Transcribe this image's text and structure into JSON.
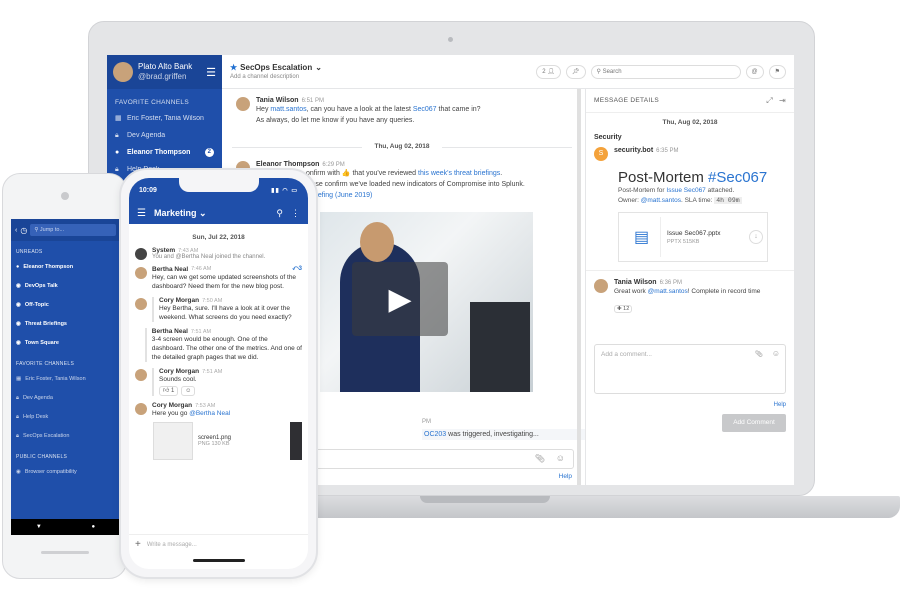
{
  "desktop": {
    "team": {
      "name": "Plato Alto Bank",
      "user": "@brad.griffen"
    },
    "sidebar": {
      "favorites_label": "FAVORITE CHANNELS",
      "channels": [
        {
          "label": "Eric Foster, Tania Wilson",
          "icon": "group-icon"
        },
        {
          "label": "Dev Agenda",
          "icon": "lock-icon"
        },
        {
          "label": "Eleanor Thompson",
          "icon": "user-icon",
          "badge": "2"
        },
        {
          "label": "Help Desk",
          "icon": "lock-icon"
        }
      ]
    },
    "header": {
      "channel": "SecOps Escalation",
      "description": "Add a channel description",
      "member_count": "2",
      "search_placeholder": "Search"
    },
    "messages": {
      "m1": {
        "name": "Tania Wilson",
        "time": "6:51 PM",
        "line1_pre": "Hey ",
        "line1_link": "matt.santos",
        "line1_mid": ", can you have a look at the latest ",
        "line1_link2": "Sec067",
        "line1_post": " that came in?",
        "line2": "As always, do let me know if you have any queries."
      },
      "date_sep": "Thu, Aug 02, 2018",
      "m2": {
        "name": "Eleanor Thompson",
        "time": "6:29 PM",
        "line1_pre": "onfirm with ",
        "line1_emoji": "👍",
        "line1_mid": " that you've reviewed ",
        "line1_link": "this week's threat briefings",
        "line1_post": ".",
        "line2": "lease confirm we've loaded new indicators of Compromise into Splunk.",
        "line3": "riefing (June 2019)"
      },
      "line_pm": "PM",
      "line_last_link": "OC203",
      "line_last": " was triggered, investigating...",
      "help": "Help"
    },
    "details": {
      "title": "MESSAGE DETAILS",
      "date": "Thu, Aug 02, 2018",
      "category": "Security",
      "bot": {
        "name": "security.bot",
        "time": "6:35 PM"
      },
      "post_mortem": "Post-Mortem ",
      "post_tag": "#Sec067",
      "line1_pre": "Post-Mortem for ",
      "line1_link": "Issue Sec067",
      "line1_post": " attached.",
      "line2_pre": "Owner: ",
      "line2_link": "@matt.santos",
      "line2_mid": ". SLA time: ",
      "line2_sla": "4h 09m",
      "file": {
        "name": "Issue Sec067.pptx",
        "size": "PPTX 515KB"
      },
      "reply": {
        "name": "Tania Wilson",
        "time": "6:36 PM",
        "pre": "Great work ",
        "link": "@matt.santos",
        "post": "! Complete in record time",
        "reaction": "12"
      },
      "comment_placeholder": "Add a comment...",
      "help": "Help",
      "add_button": "Add Comment"
    }
  },
  "android": {
    "search": "Jump to...",
    "unreads_label": "UNREADS",
    "unreads": [
      "Eleanor Thompson",
      "DevOps Talk",
      "Off-Topic",
      "Threat Briefings",
      "Town Square"
    ],
    "favorites_label": "FAVORITE CHANNELS",
    "favorites": [
      "Eric Foster, Tania Wilson",
      "Dev Agenda",
      "Help Desk",
      "SecOps Escalation"
    ],
    "public_label": "PUBLIC CHANNELS",
    "public": [
      "Browser compatibility"
    ]
  },
  "iphone": {
    "time": "10:09",
    "channel": "Marketing",
    "date": "Sun, Jul 22, 2018",
    "messages": [
      {
        "name": "System",
        "time": "7:43 AM",
        "text": "You and @Bertha Neal joined the channel."
      },
      {
        "name": "Bertha Neal",
        "time": "7:46 AM",
        "text": "Hey, can we get some updated screenshots of the dashboard? Need them for the new blog post.",
        "replies": "3"
      },
      {
        "name": "Cory Morgan",
        "time": "7:50 AM",
        "text": "Hey Bertha, sure. I'll have a look at it over the weekend. What screens do you need exactly?"
      },
      {
        "name": "Bertha Neal",
        "time": "7:51 AM",
        "text": "3-4 screen would be enough. One of the dashboard. The other one of the metrics. And one of the detailed graph pages that we did."
      },
      {
        "name": "Cory Morgan",
        "time": "7:51 AM",
        "text": "Sounds cool.",
        "reaction": "1"
      },
      {
        "name": "Cory Morgan",
        "time": "7:53 AM",
        "text_pre": "Here you go ",
        "text_link": "@Bertha Neal"
      }
    ],
    "file": {
      "name": "screen1.png",
      "size": "PNG 130 KB"
    },
    "compose_placeholder": "Write a message..."
  }
}
